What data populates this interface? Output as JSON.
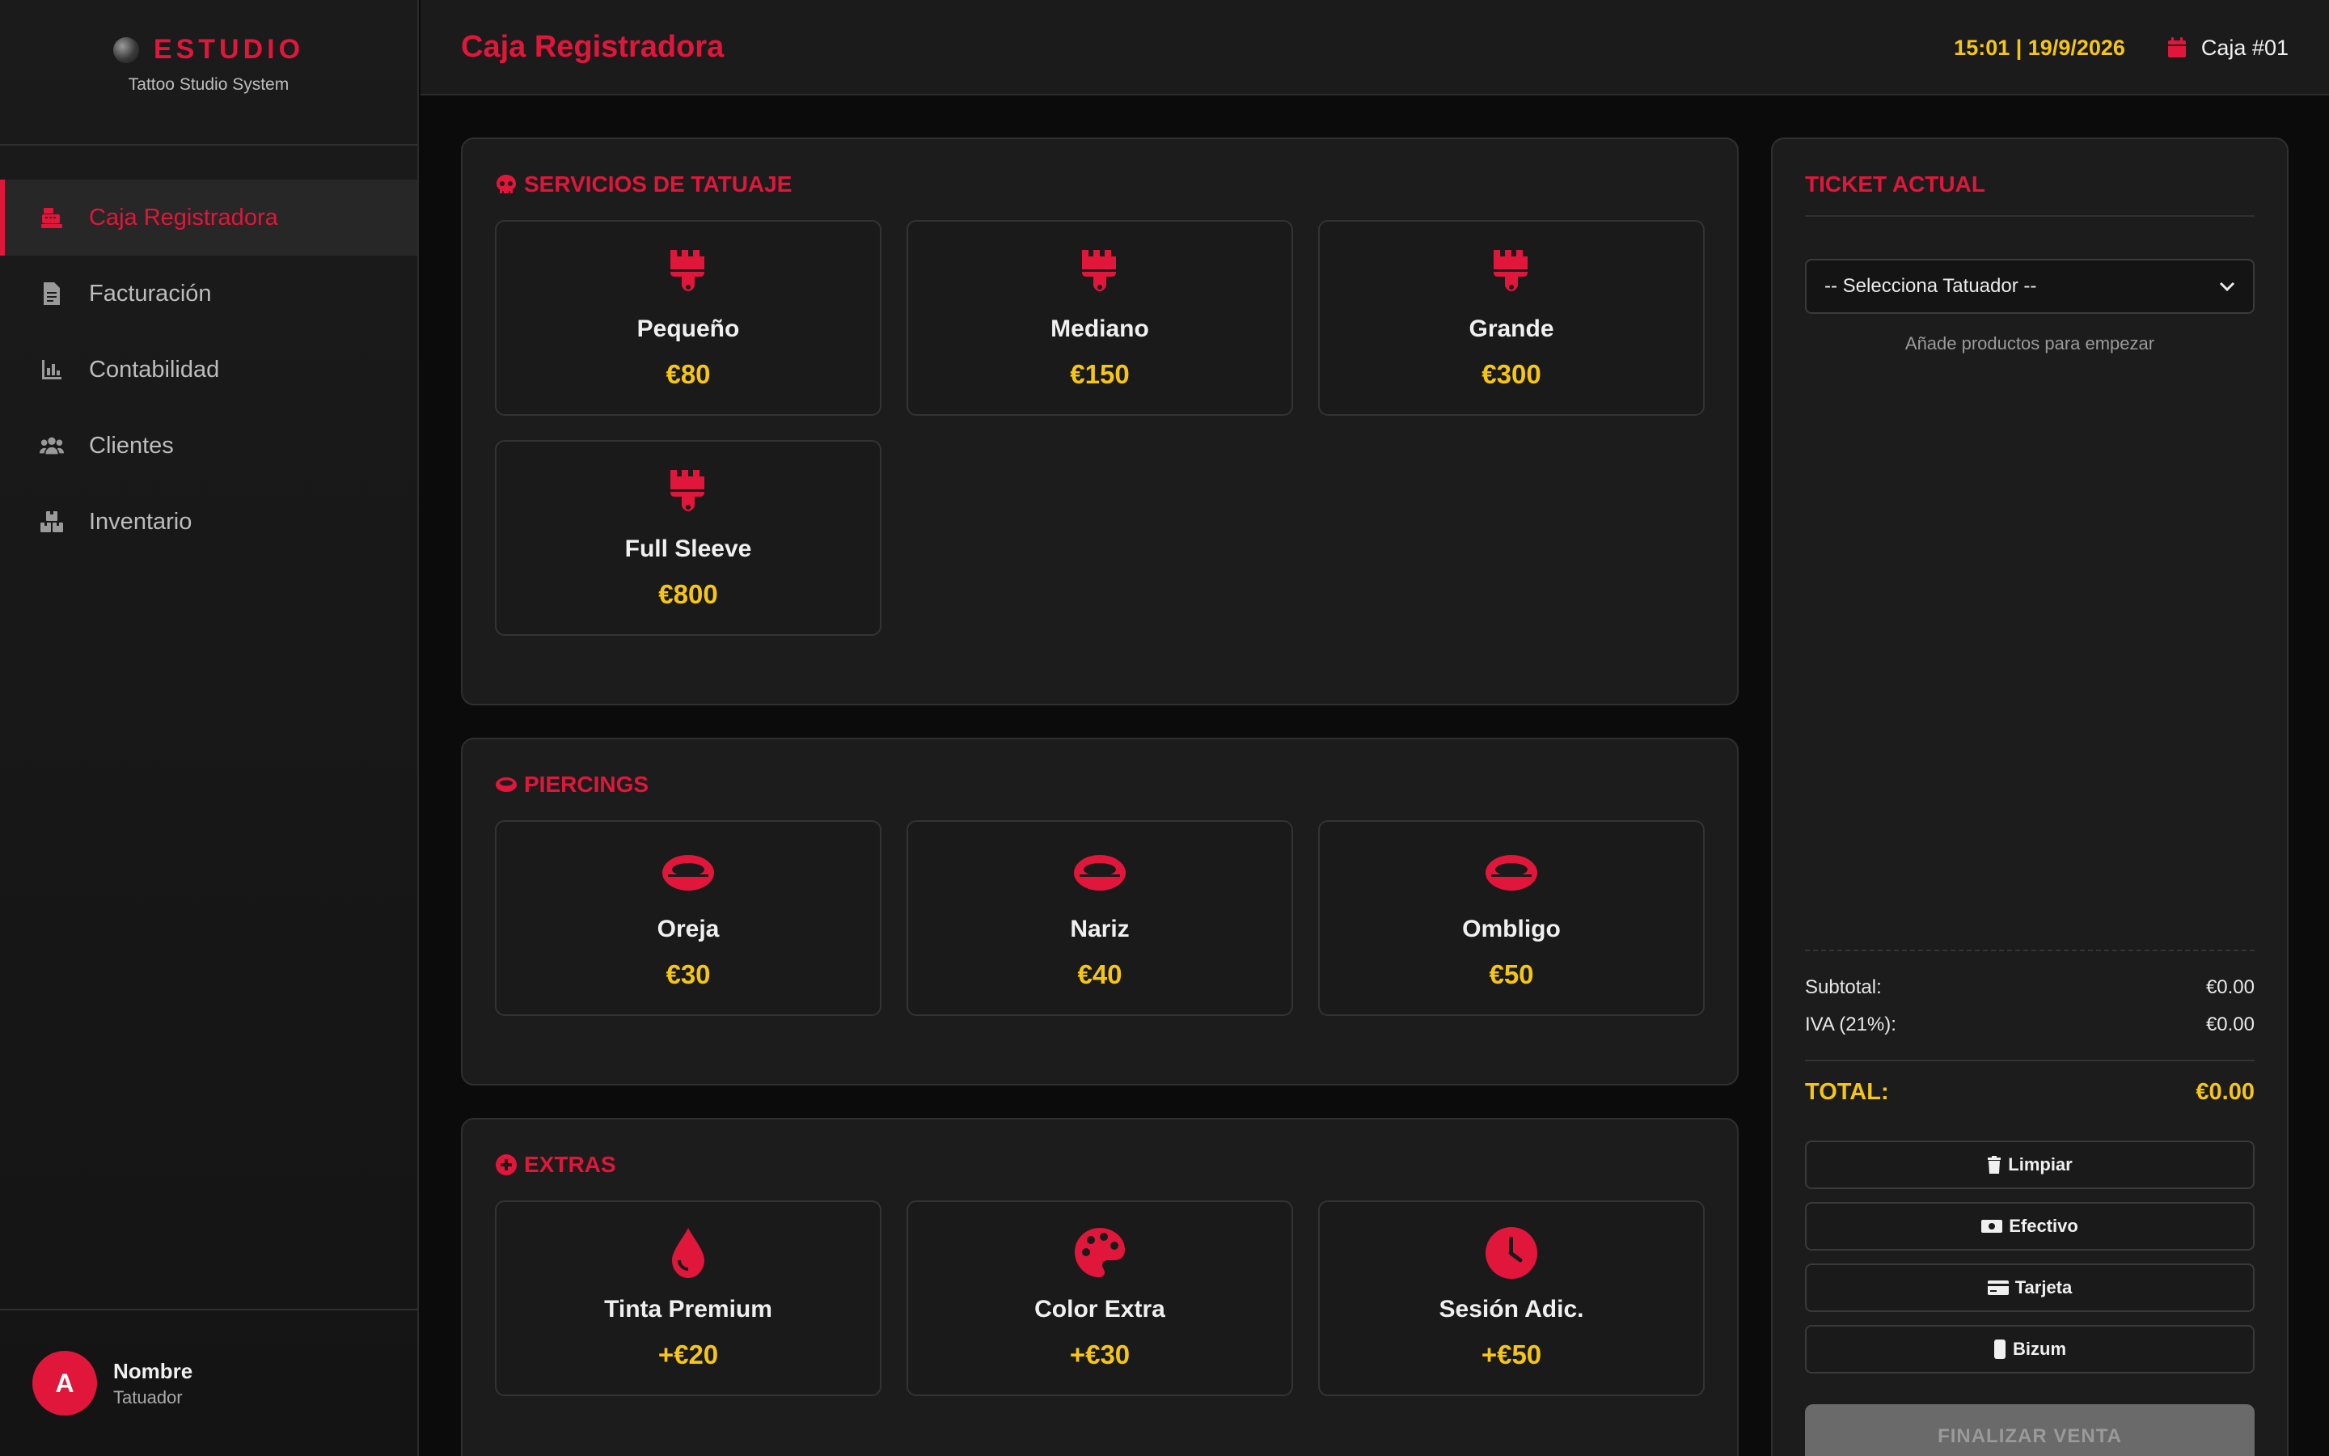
{
  "sidebar": {
    "brand_title": "ESTUDIO",
    "brand_subtitle": "Tattoo Studio System",
    "items": [
      {
        "label": "Caja Registradora",
        "icon": "cash-register-icon",
        "active": true
      },
      {
        "label": "Facturación",
        "icon": "invoice-icon",
        "active": false
      },
      {
        "label": "Contabilidad",
        "icon": "chart-icon",
        "active": false
      },
      {
        "label": "Clientes",
        "icon": "users-icon",
        "active": false
      },
      {
        "label": "Inventario",
        "icon": "boxes-icon",
        "active": false
      }
    ],
    "user": {
      "initial": "A",
      "name": "Nombre",
      "role": "Tatuador"
    }
  },
  "header": {
    "title": "Caja Registradora",
    "datetime": "15:01 | 19/9/2026",
    "register": "Caja #01"
  },
  "sections": {
    "tattoo": {
      "title": "SERVICIOS DE TATUAJE",
      "items": [
        {
          "name": "Pequeño",
          "price": "€80"
        },
        {
          "name": "Mediano",
          "price": "€150"
        },
        {
          "name": "Grande",
          "price": "€300"
        },
        {
          "name": "Full Sleeve",
          "price": "€800"
        }
      ]
    },
    "piercings": {
      "title": "PIERCINGS",
      "items": [
        {
          "name": "Oreja",
          "price": "€30"
        },
        {
          "name": "Nariz",
          "price": "€40"
        },
        {
          "name": "Ombligo",
          "price": "€50"
        }
      ]
    },
    "extras": {
      "title": "EXTRAS",
      "items": [
        {
          "name": "Tinta Premium",
          "price": "+€20",
          "icon": "ink-drop-icon"
        },
        {
          "name": "Color Extra",
          "price": "+€30",
          "icon": "palette-icon"
        },
        {
          "name": "Sesión Adic.",
          "price": "+€50",
          "icon": "clock-icon"
        }
      ]
    }
  },
  "ticket": {
    "title": "TICKET ACTUAL",
    "select_value": "-- Selecciona Tatuador --",
    "empty_text": "Añade productos para empezar",
    "subtotal_label": "Subtotal:",
    "subtotal_value": "€0.00",
    "iva_label": "IVA (21%):",
    "iva_value": "€0.00",
    "total_label": "TOTAL:",
    "total_value": "€0.00",
    "buttons": {
      "clear": "Limpiar",
      "cash": "Efectivo",
      "card": "Tarjeta",
      "bizum": "Bizum"
    },
    "finalize": "FINALIZAR VENTA"
  },
  "colors": {
    "accent": "#e0173a",
    "price": "#f5c518",
    "background": "#0b0b0b"
  }
}
